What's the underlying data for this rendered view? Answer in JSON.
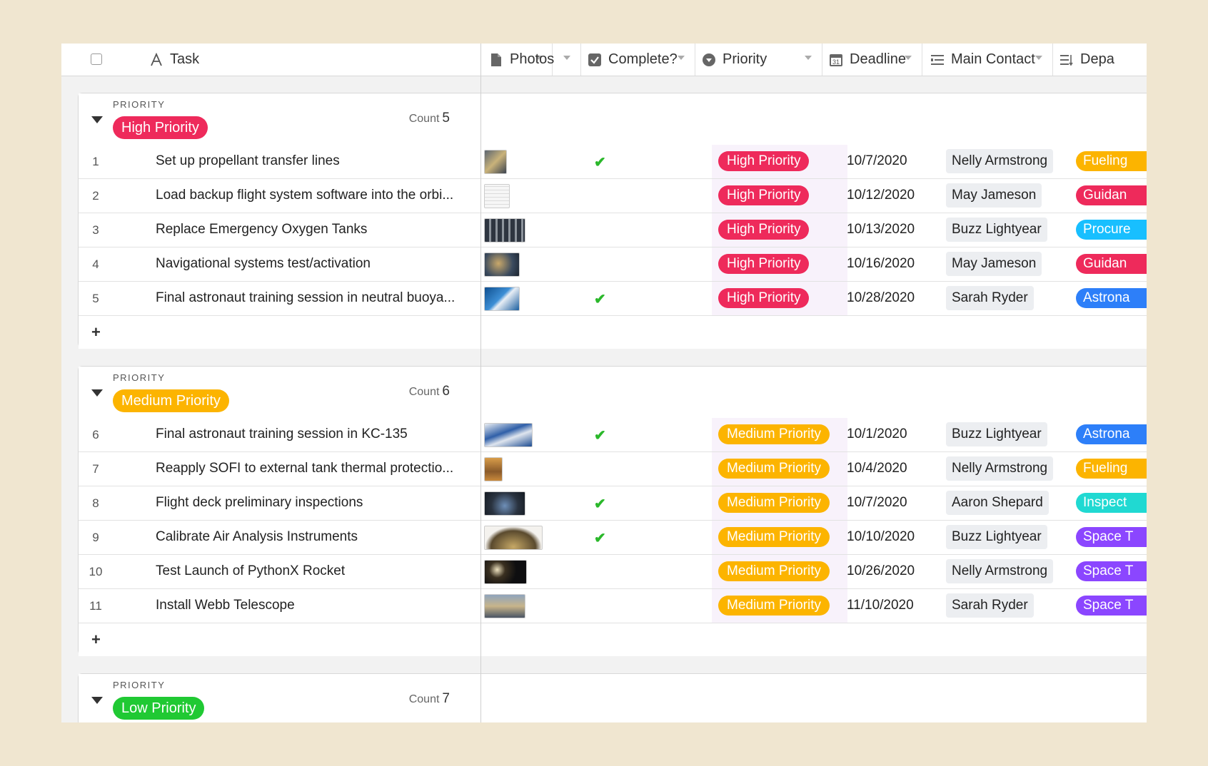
{
  "header": {
    "columns": [
      {
        "label": "Task",
        "icon": "text-field-icon"
      },
      {
        "label": "Photos",
        "icon": "attachment-icon"
      },
      {
        "label": "Complete?",
        "icon": "checkbox-field-icon"
      },
      {
        "label": "Priority",
        "icon": "single-select-icon"
      },
      {
        "label": "Deadline",
        "icon": "calendar-icon"
      },
      {
        "label": "Main Contact",
        "icon": "linked-record-icon"
      },
      {
        "label": "Depa",
        "icon": "multi-select-icon"
      }
    ]
  },
  "colors": {
    "high": "#ee2a5b",
    "medium": "#fcb400",
    "low": "#20c933",
    "fueling": "#fcb400",
    "guidance": "#ee2a5b",
    "procurement": "#18bfff",
    "astronaut": "#2d7ff9",
    "inspection": "#20d9d2",
    "space": "#8b46ff"
  },
  "groups": [
    {
      "label": "PRIORITY",
      "name": "High Priority",
      "count_label": "Count",
      "count": "5",
      "rows": [
        {
          "num": "1",
          "task": "Set up propellant transfer lines",
          "complete": true,
          "priority": "High Priority",
          "deadline": "10/7/2020",
          "contact": "Nelly Armstrong",
          "dept": "Fueling"
        },
        {
          "num": "2",
          "task": "Load backup flight system software into the orbi...",
          "complete": false,
          "priority": "High Priority",
          "deadline": "10/12/2020",
          "contact": "May Jameson",
          "dept": "Guidan"
        },
        {
          "num": "3",
          "task": "Replace Emergency Oxygen Tanks",
          "complete": false,
          "priority": "High Priority",
          "deadline": "10/13/2020",
          "contact": "Buzz Lightyear",
          "dept": "Procure"
        },
        {
          "num": "4",
          "task": "Navigational systems test/activation",
          "complete": false,
          "priority": "High Priority",
          "deadline": "10/16/2020",
          "contact": "May Jameson",
          "dept": "Guidan"
        },
        {
          "num": "5",
          "task": "Final astronaut training session in neutral buoya...",
          "complete": true,
          "priority": "High Priority",
          "deadline": "10/28/2020",
          "contact": "Sarah Ryder",
          "dept": "Astrona"
        }
      ]
    },
    {
      "label": "PRIORITY",
      "name": "Medium Priority",
      "count_label": "Count",
      "count": "6",
      "rows": [
        {
          "num": "6",
          "task": "Final astronaut training session in KC-135",
          "complete": true,
          "priority": "Medium Priority",
          "deadline": "10/1/2020",
          "contact": "Buzz Lightyear",
          "dept": "Astrona"
        },
        {
          "num": "7",
          "task": "Reapply SOFI to external tank thermal protectio...",
          "complete": false,
          "priority": "Medium Priority",
          "deadline": "10/4/2020",
          "contact": "Nelly Armstrong",
          "dept": "Fueling"
        },
        {
          "num": "8",
          "task": "Flight deck preliminary inspections",
          "complete": true,
          "priority": "Medium Priority",
          "deadline": "10/7/2020",
          "contact": "Aaron Shepard",
          "dept": "Inspect"
        },
        {
          "num": "9",
          "task": "Calibrate Air Analysis Instruments",
          "complete": true,
          "priority": "Medium Priority",
          "deadline": "10/10/2020",
          "contact": "Buzz Lightyear",
          "dept": "Space T"
        },
        {
          "num": "10",
          "task": "Test Launch of PythonX Rocket",
          "complete": false,
          "priority": "Medium Priority",
          "deadline": "10/26/2020",
          "contact": "Nelly Armstrong",
          "dept": "Space T"
        },
        {
          "num": "11",
          "task": "Install Webb Telescope",
          "complete": false,
          "priority": "Medium Priority",
          "deadline": "11/10/2020",
          "contact": "Sarah Ryder",
          "dept": "Space T"
        }
      ]
    },
    {
      "label": "PRIORITY",
      "name": "Low Priority",
      "count_label": "Count",
      "count": "7",
      "rows": []
    }
  ],
  "add_row_symbol": "+"
}
